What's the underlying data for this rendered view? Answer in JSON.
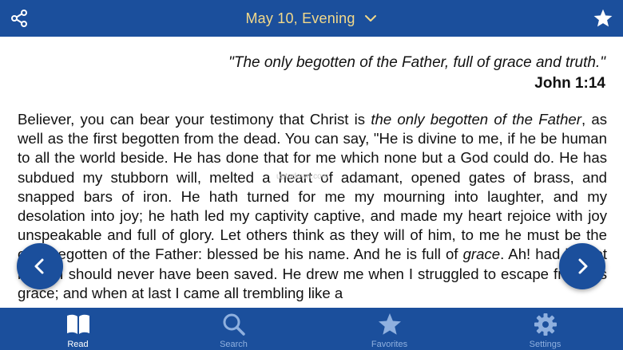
{
  "header": {
    "title": "May 10, Evening",
    "share_icon": "share-icon",
    "dropdown_icon": "chevron-down-icon",
    "favorite_icon": "star-icon",
    "title_color": "#f3d98a",
    "bar_color": "#1b4f9c"
  },
  "reading": {
    "verse": "\"The only begotten of the Father, full of grace and truth.\"",
    "reference": "John 1:14",
    "body_part1": "Believer, you can bear your testimony that Christ is ",
    "body_italic1": "the only begotten of the Father",
    "body_part2": ", as well as the first begotten from the dead. You can say, \"He is divine to me, if he be human to all the world beside. He has done that for me which none but a God could do. He has subdued my stubborn will, melted a heart of adamant, opened gates of brass, and snapped bars of iron. He hath turned for me my mourning into laughter, and my desolation into joy; he hath led my captivity captive, and made my heart rejoice with joy unspeakable and full of glory. Let others think as they will of him, to me he must be the only begotten of the Father: blessed be his name. And he is full of ",
    "body_italic2": "grace",
    "body_part3": ". Ah! had he not been, I should never have been saved. He drew me when I struggled to escape from his grace; and when at last I came all trembling like a",
    "watermark": "uptodown.com"
  },
  "navigation": {
    "prev_icon": "chevron-left-icon",
    "next_icon": "chevron-right-icon"
  },
  "tabs": [
    {
      "label": "Read",
      "icon": "book-icon",
      "active": true
    },
    {
      "label": "Search",
      "icon": "search-icon",
      "active": false
    },
    {
      "label": "Favorites",
      "icon": "star-icon",
      "active": false
    },
    {
      "label": "Settings",
      "icon": "gear-icon",
      "active": false
    }
  ]
}
